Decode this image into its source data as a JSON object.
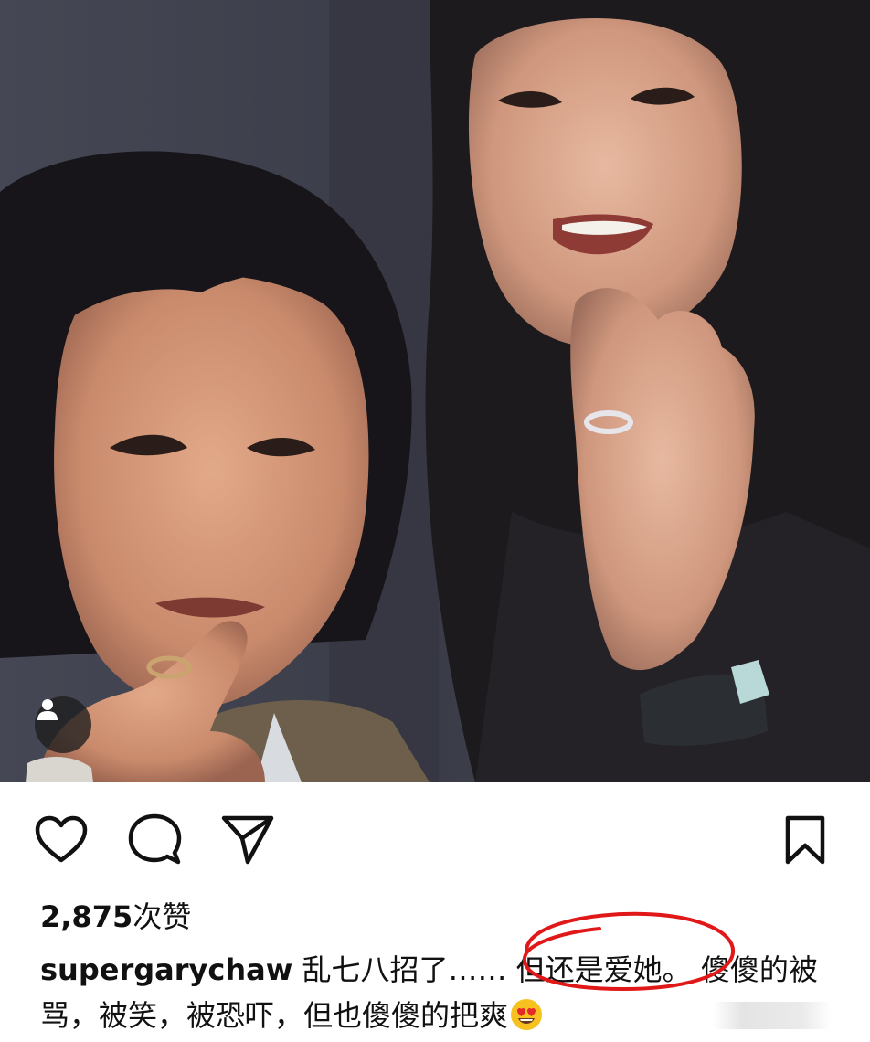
{
  "post": {
    "photo": {
      "alt": "",
      "tag_icon": "person-icon"
    },
    "actions": {
      "like_icon": "heart-icon",
      "comment_icon": "comment-bubble-icon",
      "share_icon": "paper-plane-icon",
      "save_icon": "bookmark-icon"
    },
    "likes": {
      "count": "2,875",
      "suffix": "次赞"
    },
    "caption": {
      "username": "supergarychaw",
      "text_before_highlight": " 乱七八招了…… ",
      "highlighted_text": "但还是爱她。",
      "text_after_highlight": " 傻傻的被骂，被笑，被恐吓，但也傻傻的把爽",
      "emoji_icon": "heart-eyes-emoji-icon"
    },
    "colors": {
      "highlight_circle": "#e01818",
      "text": "#111111",
      "background": "#ffffff"
    }
  }
}
